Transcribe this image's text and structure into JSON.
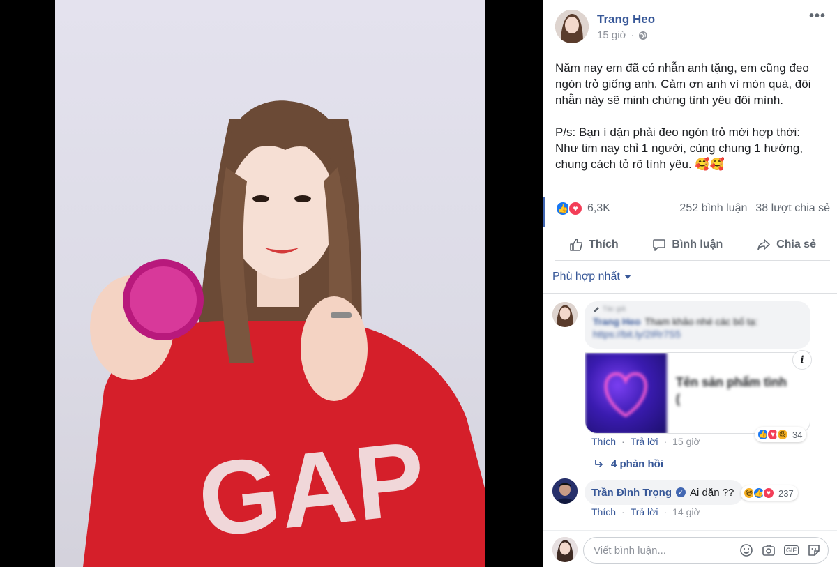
{
  "post": {
    "author": "Trang Heo",
    "time": "15 giờ",
    "paragraph1": "Năm nay em đã có nhẫn anh tặng, em cũng đeo ngón trỏ giống anh. Cảm ơn anh vì món quà, đôi nhẫn này sẽ minh chứng tình yêu đôi mình.",
    "paragraph2": "P/s: Bạn í dặn phải đeo ngón trỏ mới hợp thời: Như tim nay chỉ 1 người, cùng chung 1 hướng, chung cách tỏ rõ tình yêu. 🥰🥰"
  },
  "stats": {
    "reactions": "6,3K",
    "comments": "252 bình luận",
    "shares": "38 lượt chia sẻ"
  },
  "actions": {
    "like": "Thích",
    "comment": "Bình luận",
    "share": "Chia sẻ"
  },
  "sort": {
    "label": "Phù hợp nhất"
  },
  "comments": [
    {
      "badge": "Tác giả",
      "author": "Trang Heo",
      "text": "Tham khảo nhé các bố tạ:",
      "link": "https://bit.ly/2IRr7S5",
      "preview_title": "Tên sản phẩm tình (",
      "like_label": "Thích",
      "reply_label": "Trả lời",
      "time": "15 giờ",
      "reaction_count": "34"
    },
    {
      "author": "Trần Đình Trọng",
      "text": "Ai dặn ??",
      "like_label": "Thích",
      "reply_label": "Trả lời",
      "time": "14 giờ",
      "reaction_count": "237"
    }
  ],
  "replies": {
    "label": "4 phản hồi"
  },
  "composer": {
    "placeholder": "Viết bình luận..."
  },
  "colors": {
    "link": "#385898",
    "like_blue": "#1877f2",
    "love_red": "#f33e58",
    "haha_yellow": "#f7b125",
    "panel_edge": "#4267b2"
  }
}
